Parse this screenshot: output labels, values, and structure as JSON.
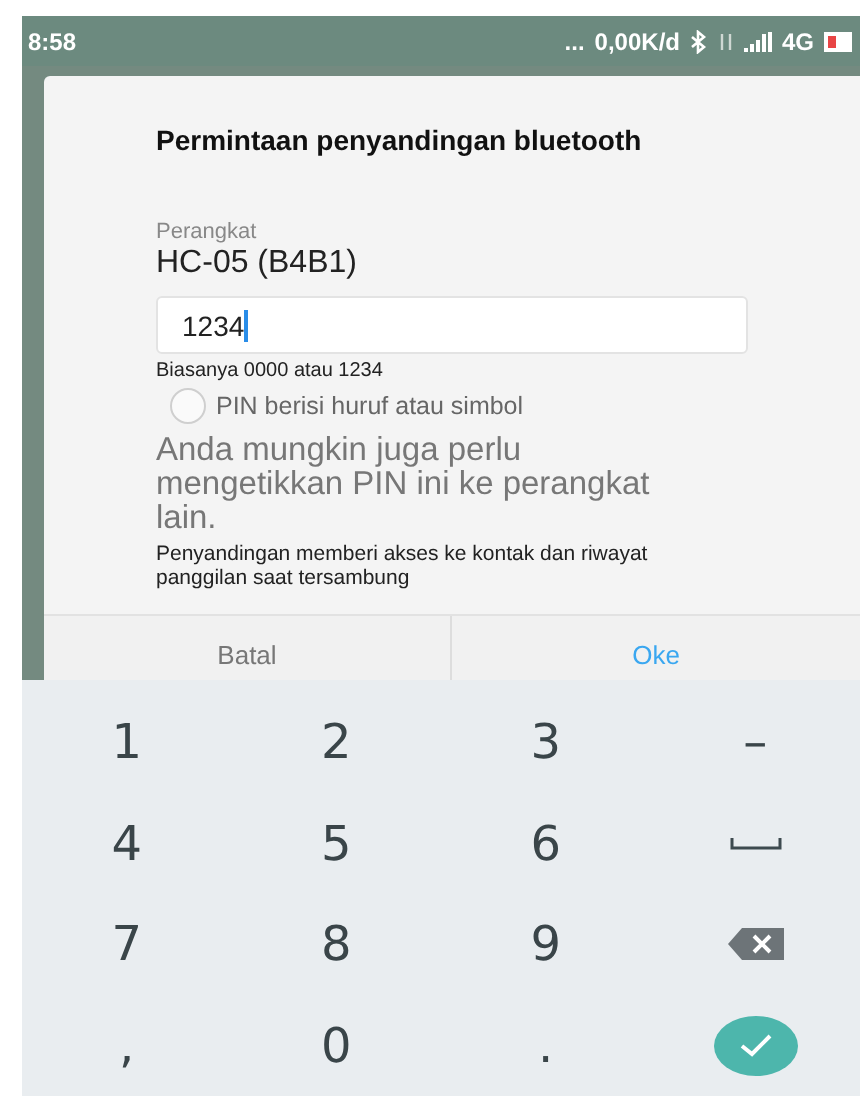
{
  "status_bar": {
    "time": "8:58",
    "more": "...",
    "speed": "0,00K/d",
    "network": "4G"
  },
  "dialog": {
    "title": "Permintaan penyandingan bluetooth",
    "device_label": "Perangkat",
    "device_name": "HC-05 (B4B1)",
    "pin_field": {
      "value": "1234"
    },
    "hint": "Biasanya 0000 atau 1234",
    "option": {
      "label": "PIN berisi huruf atau simbol",
      "checked": false
    },
    "note": "Anda mungkin juga perlu mengetikkan PIN ini ke perangkat lain.",
    "privacy": "Penyandingan memberi akses ke kontak dan riwayat panggilan saat tersambung",
    "buttons": [
      {
        "label": "Batal",
        "kind": "cancel"
      },
      {
        "label": "Oke",
        "kind": "ok"
      }
    ]
  },
  "keyboard": {
    "keys": [
      {
        "kind": "char",
        "label": "1"
      },
      {
        "kind": "char",
        "label": "2"
      },
      {
        "kind": "char",
        "label": "3"
      },
      {
        "kind": "char",
        "label": "–"
      },
      {
        "kind": "char",
        "label": "4"
      },
      {
        "kind": "char",
        "label": "5"
      },
      {
        "kind": "char",
        "label": "6"
      },
      {
        "kind": "space"
      },
      {
        "kind": "char",
        "label": "7"
      },
      {
        "kind": "char",
        "label": "8"
      },
      {
        "kind": "char",
        "label": "9"
      },
      {
        "kind": "backspace"
      },
      {
        "kind": "char",
        "label": ","
      },
      {
        "kind": "char",
        "label": "0"
      },
      {
        "kind": "char",
        "label": "."
      },
      {
        "kind": "done"
      }
    ]
  }
}
